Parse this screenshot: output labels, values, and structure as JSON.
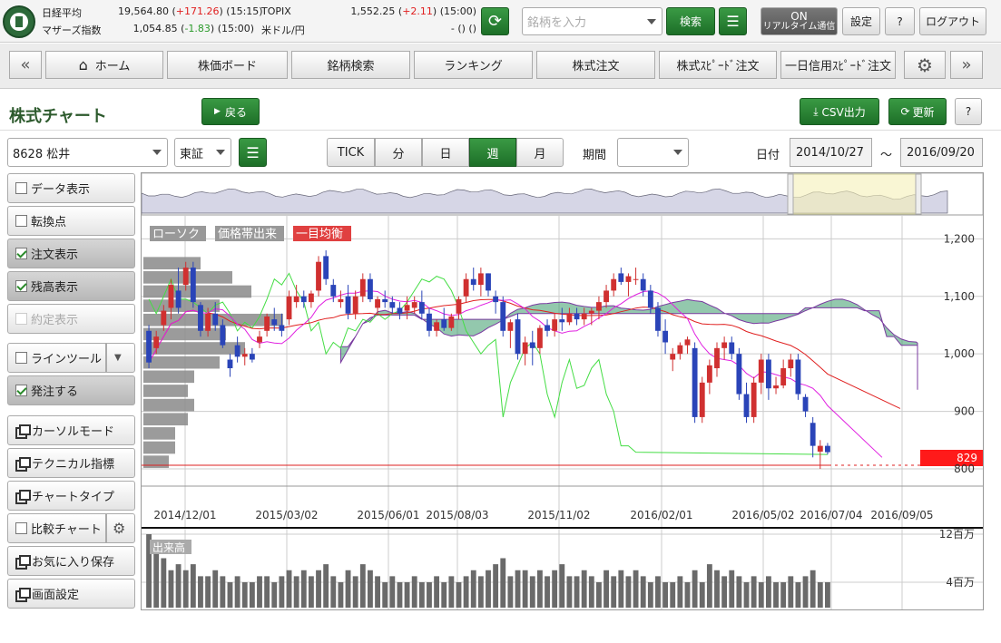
{
  "market": {
    "nikkei_label": "日経平均",
    "nikkei_value": "19,564.80",
    "nikkei_change": "+171.26",
    "nikkei_time": "(15:15)",
    "topix_label": "TOPIX",
    "topix_value": "1,552.25",
    "topix_change": "+2.11",
    "topix_time": "(15:00)",
    "mothers_label": "マザーズ指数",
    "mothers_value": "1,054.85",
    "mothers_change": "-1.83",
    "mothers_time": "(15:00)",
    "usdjpy_label": "米ドル/円",
    "usdjpy_value": "-",
    "usdjpy_change": "()",
    "usdjpy_time": "()"
  },
  "topbar": {
    "search_placeholder": "銘柄を入力",
    "search_button": "検索",
    "realtime_on": "ON",
    "realtime_label": "リアルタイム通信",
    "settings": "設定",
    "help": "?",
    "logout": "ログアウト"
  },
  "nav": {
    "tabs": [
      "ホーム",
      "株価ボード",
      "銘柄検索",
      "ランキング",
      "株式注文",
      "株式ｽﾋﾟｰﾄﾞ注文",
      "一日信用ｽﾋﾟｰﾄﾞ注文"
    ]
  },
  "header": {
    "title": "株式チャート",
    "back": "戻る",
    "csv": "CSV出力",
    "refresh": "更新",
    "help": "?"
  },
  "controls": {
    "stock": "8628 松井",
    "market": "東証",
    "periods": [
      "TICK",
      "分",
      "日",
      "週",
      "月"
    ],
    "active_period": "週",
    "term_label": "期間",
    "term_value": "",
    "date_label": "日付",
    "date_from": "2014/10/27",
    "tilde": "～",
    "date_to": "2016/09/20"
  },
  "sidebar": {
    "data_display": "データ表示",
    "turning_point": "転換点",
    "order_display": "注文表示",
    "position_display": "残高表示",
    "execution_display": "約定表示",
    "line_tool": "ラインツール",
    "place_order": "発注する",
    "cursor_mode": "カーソルモード",
    "technical": "テクニカル指標",
    "chart_type": "チャートタイプ",
    "compare_chart": "比較チャート",
    "save_favorite": "お気に入り保存",
    "screen_settings": "画面設定"
  },
  "chart_labels": {
    "candle_tag": "ローソク",
    "volume_profile_tag": "価格帯出来",
    "ichimoku_tag": "一目均衡",
    "last_price": "829",
    "volume_tag": "出来高",
    "volume_ticks": [
      "12百万",
      "4百万"
    ]
  },
  "colors": {
    "up": "#d03030",
    "down": "#2a44b8",
    "cloud": "#3a9a6a",
    "accent_green": "#1d6f28",
    "price_tag": "#ff1a1a"
  },
  "chart_data": {
    "type": "candlestick",
    "title": "",
    "ylim": [
      770,
      1240
    ],
    "yticks": [
      1200,
      1100,
      1000,
      900,
      800
    ],
    "xticks": [
      "2014/12/01",
      "2015/03/02",
      "2015/06/01",
      "2015/08/03",
      "2015/11/02",
      "2016/02/01",
      "2016/05/02",
      "2016/07/04",
      "2016/09/05"
    ],
    "candles_ohlc": [
      [
        1040,
        1050,
        975,
        985
      ],
      [
        1010,
        1040,
        1000,
        1030
      ],
      [
        1050,
        1085,
        1040,
        1075
      ],
      [
        1080,
        1130,
        1060,
        1120
      ],
      [
        1110,
        1150,
        1070,
        1080
      ],
      [
        1120,
        1160,
        1110,
        1150
      ],
      [
        1150,
        1160,
        1080,
        1090
      ],
      [
        1085,
        1090,
        1030,
        1040
      ],
      [
        1040,
        1080,
        1030,
        1070
      ],
      [
        1070,
        1090,
        1040,
        1050
      ],
      [
        1050,
        1060,
        1010,
        1015
      ],
      [
        990,
        1000,
        960,
        975
      ],
      [
        1015,
        1030,
        985,
        995
      ],
      [
        995,
        1010,
        980,
        1000
      ],
      [
        1000,
        1010,
        985,
        990
      ],
      [
        1020,
        1040,
        1010,
        1030
      ],
      [
        1040,
        1070,
        1030,
        1065
      ],
      [
        1060,
        1080,
        1040,
        1050
      ],
      [
        1050,
        1070,
        1030,
        1040
      ],
      [
        1060,
        1110,
        1050,
        1100
      ],
      [
        1090,
        1120,
        1080,
        1100
      ],
      [
        1100,
        1110,
        1080,
        1090
      ],
      [
        1090,
        1110,
        1080,
        1105
      ],
      [
        1110,
        1170,
        1100,
        1160
      ],
      [
        1170,
        1180,
        1120,
        1130
      ],
      [
        1120,
        1130,
        1090,
        1100
      ],
      [
        1090,
        1110,
        1080,
        1095
      ],
      [
        1100,
        1120,
        1060,
        1070
      ],
      [
        1070,
        1110,
        1060,
        1100
      ],
      [
        1100,
        1140,
        1090,
        1130
      ],
      [
        1130,
        1140,
        1090,
        1095
      ],
      [
        1080,
        1100,
        1070,
        1095
      ],
      [
        1095,
        1110,
        1080,
        1090
      ],
      [
        1090,
        1100,
        1070,
        1080
      ],
      [
        1080,
        1090,
        1060,
        1070
      ],
      [
        1075,
        1100,
        1060,
        1085
      ],
      [
        1080,
        1100,
        1070,
        1090
      ],
      [
        1090,
        1110,
        1060,
        1070
      ],
      [
        1070,
        1080,
        1030,
        1040
      ],
      [
        1040,
        1060,
        1030,
        1055
      ],
      [
        1060,
        1080,
        1040,
        1045
      ],
      [
        1045,
        1070,
        1040,
        1065
      ],
      [
        1070,
        1100,
        1060,
        1095
      ],
      [
        1100,
        1140,
        1090,
        1130
      ],
      [
        1130,
        1150,
        1110,
        1120
      ],
      [
        1120,
        1150,
        1100,
        1140
      ],
      [
        1140,
        1140,
        1100,
        1110
      ],
      [
        1100,
        1110,
        1070,
        1090
      ],
      [
        1090,
        1100,
        1030,
        1040
      ],
      [
        1040,
        1060,
        1010,
        1055
      ],
      [
        1060,
        1070,
        990,
        1000
      ],
      [
        1000,
        1030,
        980,
        1020
      ],
      [
        1020,
        1040,
        980,
        1010
      ],
      [
        1010,
        1050,
        1000,
        1045
      ],
      [
        1050,
        1060,
        1030,
        1040
      ],
      [
        1040,
        1070,
        1030,
        1060
      ],
      [
        1060,
        1080,
        1040,
        1055
      ],
      [
        1055,
        1080,
        1050,
        1070
      ],
      [
        1070,
        1080,
        1050,
        1060
      ],
      [
        1060,
        1080,
        1050,
        1070
      ],
      [
        1070,
        1080,
        1050,
        1075
      ],
      [
        1075,
        1100,
        1060,
        1090
      ],
      [
        1090,
        1120,
        1080,
        1110
      ],
      [
        1110,
        1140,
        1100,
        1130
      ],
      [
        1140,
        1150,
        1120,
        1125
      ],
      [
        1125,
        1140,
        1100,
        1135
      ],
      [
        1130,
        1150,
        1120,
        1130
      ],
      [
        1130,
        1140,
        1100,
        1110
      ],
      [
        1110,
        1120,
        1070,
        1080
      ],
      [
        1080,
        1090,
        1030,
        1040
      ],
      [
        1040,
        1060,
        1000,
        1020
      ],
      [
        990,
        1010,
        970,
        1000
      ],
      [
        1000,
        1020,
        990,
        1015
      ],
      [
        1015,
        1030,
        1000,
        1025
      ],
      [
        1010,
        1020,
        880,
        890
      ],
      [
        890,
        960,
        880,
        950
      ],
      [
        950,
        990,
        930,
        980
      ],
      [
        975,
        1020,
        960,
        1010
      ],
      [
        1010,
        1030,
        990,
        1020
      ],
      [
        1020,
        1030,
        990,
        1000
      ],
      [
        1000,
        1010,
        920,
        930
      ],
      [
        930,
        950,
        880,
        890
      ],
      [
        890,
        960,
        880,
        950
      ],
      [
        950,
        1000,
        930,
        990
      ],
      [
        990,
        1000,
        920,
        940
      ],
      [
        940,
        960,
        930,
        945
      ],
      [
        945,
        990,
        940,
        975
      ],
      [
        975,
        1000,
        960,
        990
      ],
      [
        990,
        1000,
        920,
        930
      ],
      [
        925,
        930,
        890,
        900
      ],
      [
        880,
        890,
        820,
        840
      ],
      [
        830,
        850,
        800,
        840
      ],
      [
        840,
        845,
        825,
        829
      ]
    ],
    "volume_profile_units": [
      9,
      14,
      17,
      12,
      22,
      13,
      16,
      12,
      8,
      7,
      8,
      7,
      5,
      5,
      4
    ],
    "volume_units": [
      12,
      10,
      8,
      6,
      7,
      6,
      7,
      5,
      5,
      6,
      5,
      4,
      5,
      4,
      4,
      5,
      5,
      4,
      5,
      6,
      5,
      6,
      5,
      6,
      7,
      5,
      4,
      6,
      5,
      7,
      6,
      5,
      4,
      5,
      4,
      4,
      5,
      4,
      4,
      5,
      4,
      5,
      4,
      5,
      6,
      5,
      6,
      7,
      8,
      5,
      6,
      6,
      5,
      6,
      5,
      6,
      7,
      5,
      5,
      6,
      5,
      4,
      6,
      5,
      6,
      5,
      6,
      5,
      4,
      5,
      4,
      4,
      5,
      4,
      6,
      4,
      7,
      6,
      5,
      6,
      5,
      4,
      5,
      4,
      5,
      4,
      4,
      5,
      4,
      5,
      6,
      4,
      4,
      5,
      4,
      4
    ]
  }
}
